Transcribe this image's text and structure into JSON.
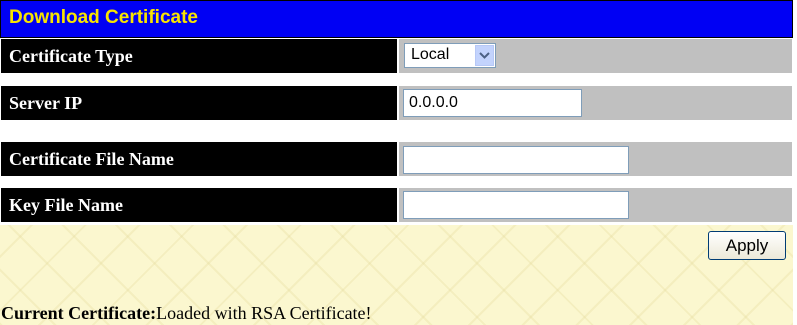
{
  "header": {
    "title": "Download Certificate"
  },
  "form": {
    "certificate_type": {
      "label": "Certificate Type",
      "value": "Local"
    },
    "server_ip": {
      "label": "Server IP",
      "value": "0.0.0.0"
    },
    "certificate_file_name": {
      "label": "Certificate File Name",
      "value": ""
    },
    "key_file_name": {
      "label": "Key File Name",
      "value": ""
    }
  },
  "actions": {
    "apply_label": "Apply"
  },
  "status": {
    "current_label": "Current Certificate:",
    "current_value": "Loaded with RSA Certificate!"
  },
  "colors": {
    "title_bg": "#0000f4",
    "title_text": "#f8e400",
    "label_bg": "#000000",
    "value_bg": "#c0c0c0",
    "bottom_bg": "#fbf7cf"
  }
}
